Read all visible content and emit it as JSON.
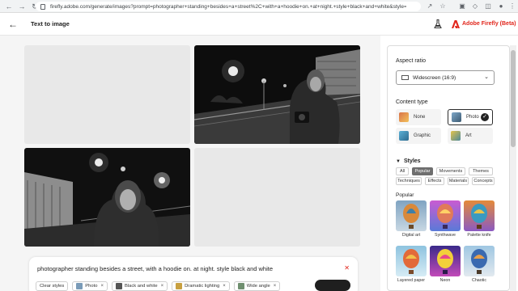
{
  "browser": {
    "url": "firefly.adobe.com/generate/images?prompt=photographer+standing+besides+a+street%2C+with+a+hoodie+on.+at+night.+style+black+and+white&style=photo&styl..."
  },
  "header": {
    "title": "Text to image",
    "brand": "Adobe Firefly (Beta)"
  },
  "prompt": {
    "text": "photographer standing besides a street, with a hoodie on. at night. style black and white",
    "chips": [
      {
        "label": "Clear styles"
      },
      {
        "label": "Photo"
      },
      {
        "label": "Black and white"
      },
      {
        "label": "Dramatic lighting"
      },
      {
        "label": "Wide angle"
      }
    ]
  },
  "panel": {
    "aspect_ratio_label": "Aspect ratio",
    "aspect_ratio_value": "Widescreen (16:9)",
    "content_type_label": "Content type",
    "content_types": [
      {
        "label": "None",
        "selected": false
      },
      {
        "label": "Photo",
        "selected": true
      },
      {
        "label": "Graphic",
        "selected": false
      },
      {
        "label": "Art",
        "selected": false
      }
    ],
    "styles_label": "Styles",
    "style_tabs": [
      "All",
      "Popular",
      "Movements",
      "Themes",
      "Techniques",
      "Effects",
      "Materials",
      "Concepts"
    ],
    "active_tab": "Popular",
    "popular_label": "Popular",
    "popular_styles": [
      "Digital art",
      "Synthwave",
      "Palette knife",
      "Layered paper",
      "Neon",
      "Chaotic"
    ]
  },
  "colors": {
    "brand_red": "#e1251b",
    "panel_border": "#dcdcdc"
  }
}
